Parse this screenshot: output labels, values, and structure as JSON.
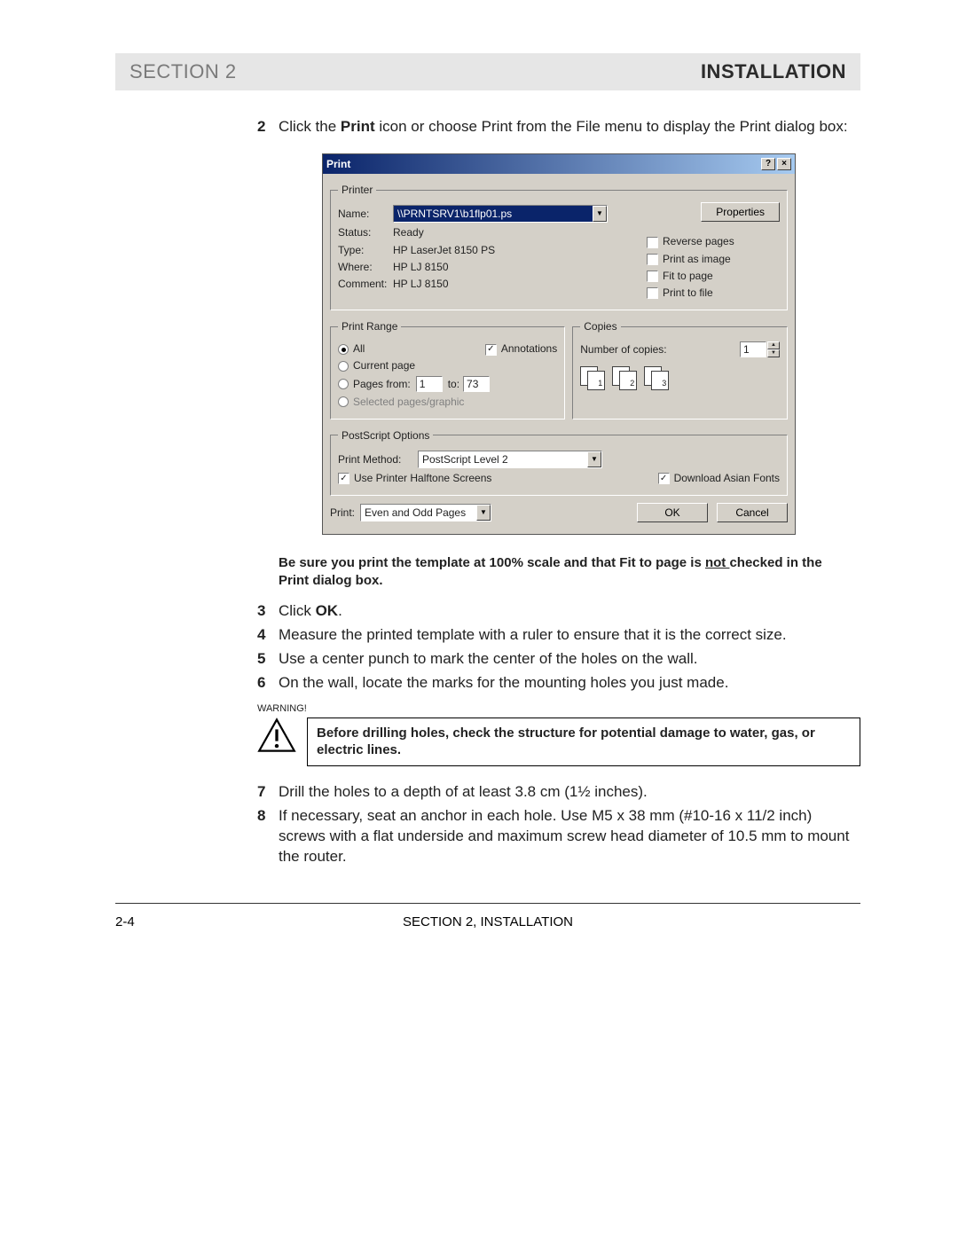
{
  "header": {
    "left": "SECTION 2",
    "right": "INSTALLATION"
  },
  "step2": {
    "num": "2",
    "t1": "Click the ",
    "t2": "Print",
    "t3": " icon or choose Print from the File menu to display the Print dialog box:"
  },
  "dialog": {
    "title": "Print",
    "help": "?",
    "close": "×",
    "printer": {
      "legend": "Printer",
      "name_lbl": "Name:",
      "name_val": "\\\\PRNTSRV1\\b1flp01.ps",
      "status_lbl": "Status:",
      "status_val": "Ready",
      "type_lbl": "Type:",
      "type_val": "HP LaserJet 8150 PS",
      "where_lbl": "Where:",
      "where_val": "HP LJ 8150",
      "comment_lbl": "Comment:",
      "comment_val": "HP LJ 8150",
      "props": "Properties",
      "reverse": "Reverse pages",
      "asimg": "Print as image",
      "fit": "Fit to page",
      "tofile": "Print to file"
    },
    "range": {
      "legend": "Print Range",
      "all": "All",
      "annot": "Annotations",
      "current": "Current page",
      "pages_from": "Pages from:",
      "from_val": "1",
      "to_lbl": "to:",
      "to_val": "73",
      "selected": "Selected pages/graphic"
    },
    "copies": {
      "legend": "Copies",
      "num_lbl": "Number of copies:",
      "num_val": "1",
      "p1": "1",
      "p2": "2",
      "p3": "3"
    },
    "ps": {
      "legend": "PostScript Options",
      "method_lbl": "Print Method:",
      "method_val": "PostScript Level 2",
      "halftone": "Use Printer Halftone Screens",
      "asian": "Download Asian Fonts"
    },
    "bottom": {
      "print_lbl": "Print:",
      "print_val": "Even and Odd Pages",
      "ok": "OK",
      "cancel": "Cancel"
    }
  },
  "note": {
    "t1": "Be sure you print the template at 100% scale and that Fit to page is ",
    "t2": "not ",
    "t3": "checked in the Print dialog box."
  },
  "step3": {
    "num": "3",
    "t1": "Click ",
    "t2": "OK",
    "t3": "."
  },
  "step4": {
    "num": "4",
    "txt": "Measure the printed template with a ruler to ensure that it is the correct size."
  },
  "step5": {
    "num": "5",
    "txt": "Use a center punch to mark the center of the holes on the wall."
  },
  "step6": {
    "num": "6",
    "txt": "On the wall, locate the marks for the mounting holes you just made."
  },
  "warn_label": "WARNING!",
  "warn_text": "Before drilling holes, check the structure for potential damage to water, gas, or electric lines.",
  "step7": {
    "num": "7",
    "txt": "Drill the holes to a depth of at least 3.8 cm (1½ inches)."
  },
  "step8": {
    "num": "8",
    "txt": "If necessary, seat an anchor in each hole. Use M5 x 38 mm (#10-16 x 11/2 inch) screws with a flat underside and maximum screw head diameter of 10.5 mm to mount the router."
  },
  "footer": {
    "pagenum": "2-4",
    "center": "SECTION 2, INSTALLATION"
  }
}
